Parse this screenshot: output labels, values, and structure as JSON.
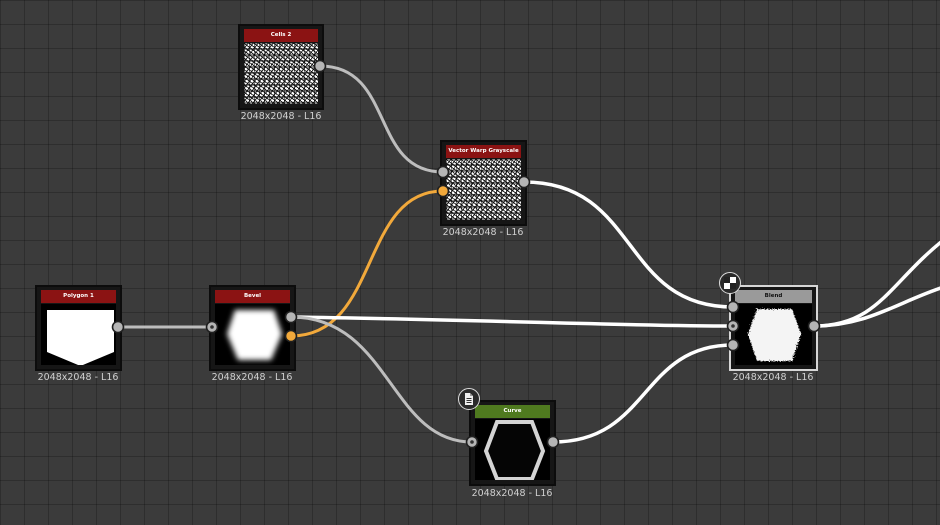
{
  "graph": {
    "nodes": [
      {
        "id": "cells2",
        "title": "Cells 2",
        "resolution": "2048x2048 - L16"
      },
      {
        "id": "vector_warp",
        "title": "Vector Warp Grayscale",
        "resolution": "2048x2048 - L16"
      },
      {
        "id": "polygon1",
        "title": "Polygon 1",
        "resolution": "2048x2048 - L16"
      },
      {
        "id": "bevel",
        "title": "Bevel",
        "resolution": "2048x2048 - L16"
      },
      {
        "id": "blend",
        "title": "Blend",
        "resolution": "2048x2048 - L16"
      },
      {
        "id": "curve",
        "title": "Curve",
        "resolution": "2048x2048 - L16"
      }
    ],
    "badges": {
      "blend": "checkerboard-icon",
      "curve": "document-icon"
    }
  },
  "colors": {
    "background": "#3b3b3b",
    "title_red": "#8b1313",
    "title_green": "#4f7a1f",
    "title_gray": "#9a9a9a",
    "link_gray": "#bdbdbd",
    "link_white": "#ffffff",
    "link_orange": "#f2a93b"
  }
}
